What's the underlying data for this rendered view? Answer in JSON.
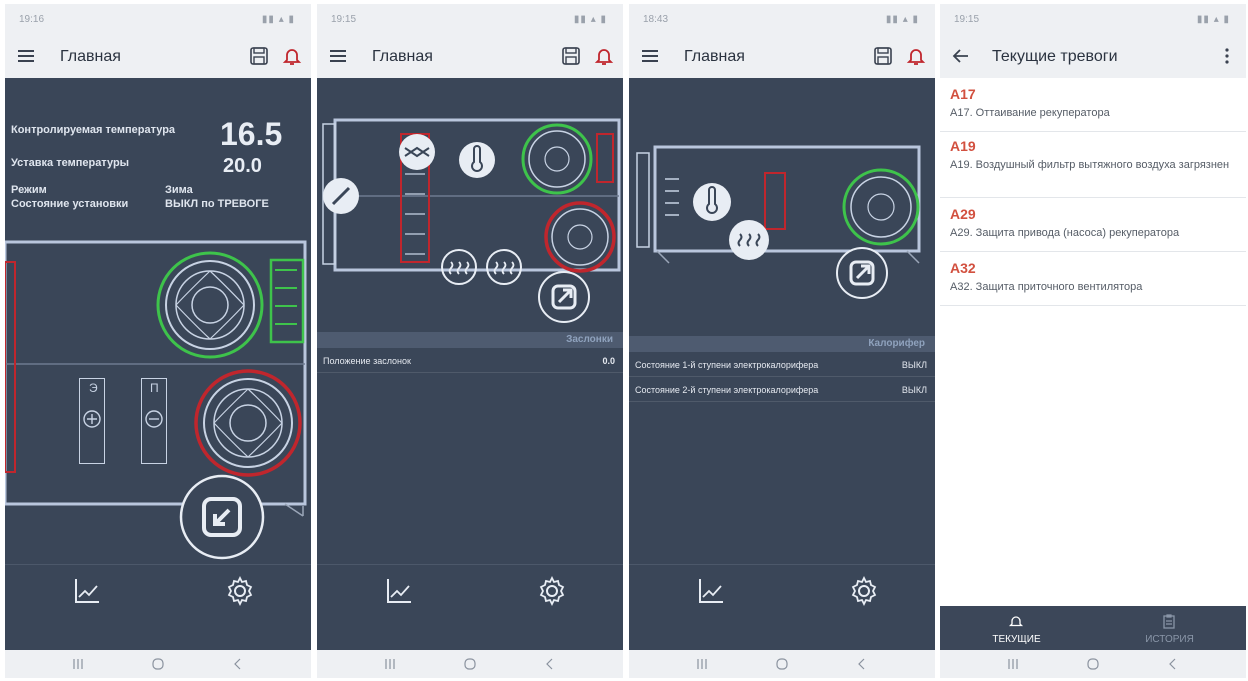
{
  "status_bar": {
    "times": [
      "19:16",
      "19:15",
      "18:43",
      "19:15"
    ]
  },
  "main_screen": {
    "title": "Главная",
    "controlled_temp_label": "Контролируемая температура",
    "controlled_temp_value": "16.5",
    "setpoint_label": "Уставка температуры",
    "setpoint_value": "20.0",
    "mode_label": "Режим",
    "mode_value": "Зима",
    "state_label": "Состояние установки",
    "state_value": "ВЫКЛ по ТРЕВОГЕ",
    "heater_labels": [
      "Э",
      "П"
    ]
  },
  "dampers_screen": {
    "title": "Главная",
    "section_title": "Заслонки",
    "rows": [
      {
        "label": "Положение заслонок",
        "value": "0.0"
      }
    ]
  },
  "heater_screen": {
    "title": "Главная",
    "section_title": "Калорифер",
    "rows": [
      {
        "label": "Состояние 1-й ступени электрокалорифера",
        "value": "ВЫКЛ"
      },
      {
        "label": "Состояние 2-й ступени электрокалорифера",
        "value": "ВЫКЛ"
      }
    ]
  },
  "alarms_screen": {
    "title": "Текущие тревоги",
    "alarms": [
      {
        "code": "A17",
        "desc": "А17. Оттаивание рекуператора"
      },
      {
        "code": "A19",
        "desc": "А19. Воздушный фильтр вытяжного воздуха загрязнен"
      },
      {
        "code": "A29",
        "desc": "А29. Защита привода (насоса) рекуператора"
      },
      {
        "code": "A32",
        "desc": "А32. Защита приточного вентилятора"
      }
    ],
    "tabs": {
      "current": "ТЕКУЩИЕ",
      "history": "ИСТОРИЯ"
    }
  },
  "colors": {
    "panel_bg": "#3a4658",
    "running_green": "#3ec34b",
    "alarm_red": "#c0262d",
    "alarm_code": "#d2503f",
    "section_header": "#4e5b70"
  },
  "icons": [
    "menu-icon",
    "save-icon",
    "bell-alarm-icon",
    "back-arrow-icon",
    "more-icon",
    "chart-icon",
    "gear-icon",
    "fan-icon",
    "thermometer-icon",
    "heater-icon",
    "expand-icon",
    "collapse-icon"
  ]
}
